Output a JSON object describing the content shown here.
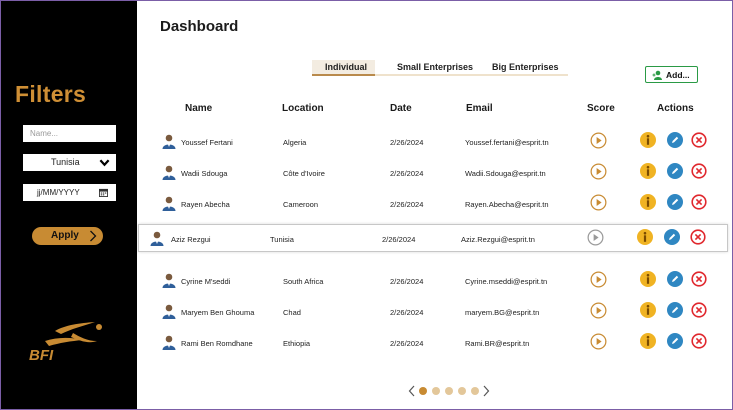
{
  "sidebar": {
    "title": "Filters",
    "name_placeholder": "Name...",
    "country_value": "Tunisia",
    "date_value": "jj/MM/YYYY",
    "apply_label": "Apply",
    "logo_text": "BFI"
  },
  "main": {
    "title": "Dashboard",
    "tabs": [
      {
        "label": "Individual",
        "active": true
      },
      {
        "label": "Small Enterprises",
        "active": false
      },
      {
        "label": "Big Enterprises",
        "active": false
      }
    ],
    "add_label": "Add...",
    "columns": [
      "Name",
      "Location",
      "Date",
      "Email",
      "Score",
      "Actions"
    ],
    "rows": [
      {
        "name": "Youssef Fertani",
        "location": "Algeria",
        "date": "2/26/2024",
        "email": "Youssef.fertani@esprit.tn"
      },
      {
        "name": "Wadii Sdouga",
        "location": "Côte d'Ivoire",
        "date": "2/26/2024",
        "email": "Wadii.Sdouga@esprit.tn"
      },
      {
        "name": "Rayen Abecha",
        "location": "Cameroon",
        "date": "2/26/2024",
        "email": "Rayen.Abecha@esprit.tn"
      },
      {
        "name": "Aziz Rezgui",
        "location": "Tunisia",
        "date": "2/26/2024",
        "email": "Aziz.Rezgui@esprit.tn",
        "selected": true
      },
      {
        "name": "Cyrine M'seddi",
        "location": "South Africa",
        "date": "2/26/2024",
        "email": "Cyrine.mseddi@esprit.tn"
      },
      {
        "name": "Maryem Ben Ghouma",
        "location": "Chad",
        "date": "2/26/2024",
        "email": "maryem.BG@esprit.tn"
      },
      {
        "name": "Rami Ben Romdhane",
        "location": "Ethiopia",
        "date": "2/26/2024",
        "email": "Rami.BR@esprit.tn"
      }
    ],
    "pagination": {
      "pages": 5,
      "current": 1
    }
  },
  "colors": {
    "accent": "#c88b33",
    "sidebar_bg": "#000000",
    "info": "#f0b323",
    "edit": "#2f87c2",
    "delete": "#e0282e",
    "add_border": "#2a9a45"
  },
  "icons": [
    "user-avatar-icon",
    "play-score-icon",
    "info-icon",
    "edit-pencil-icon",
    "delete-x-icon",
    "add-user-icon",
    "chevron-down-icon",
    "calendar-icon",
    "arrow-right-icon"
  ]
}
